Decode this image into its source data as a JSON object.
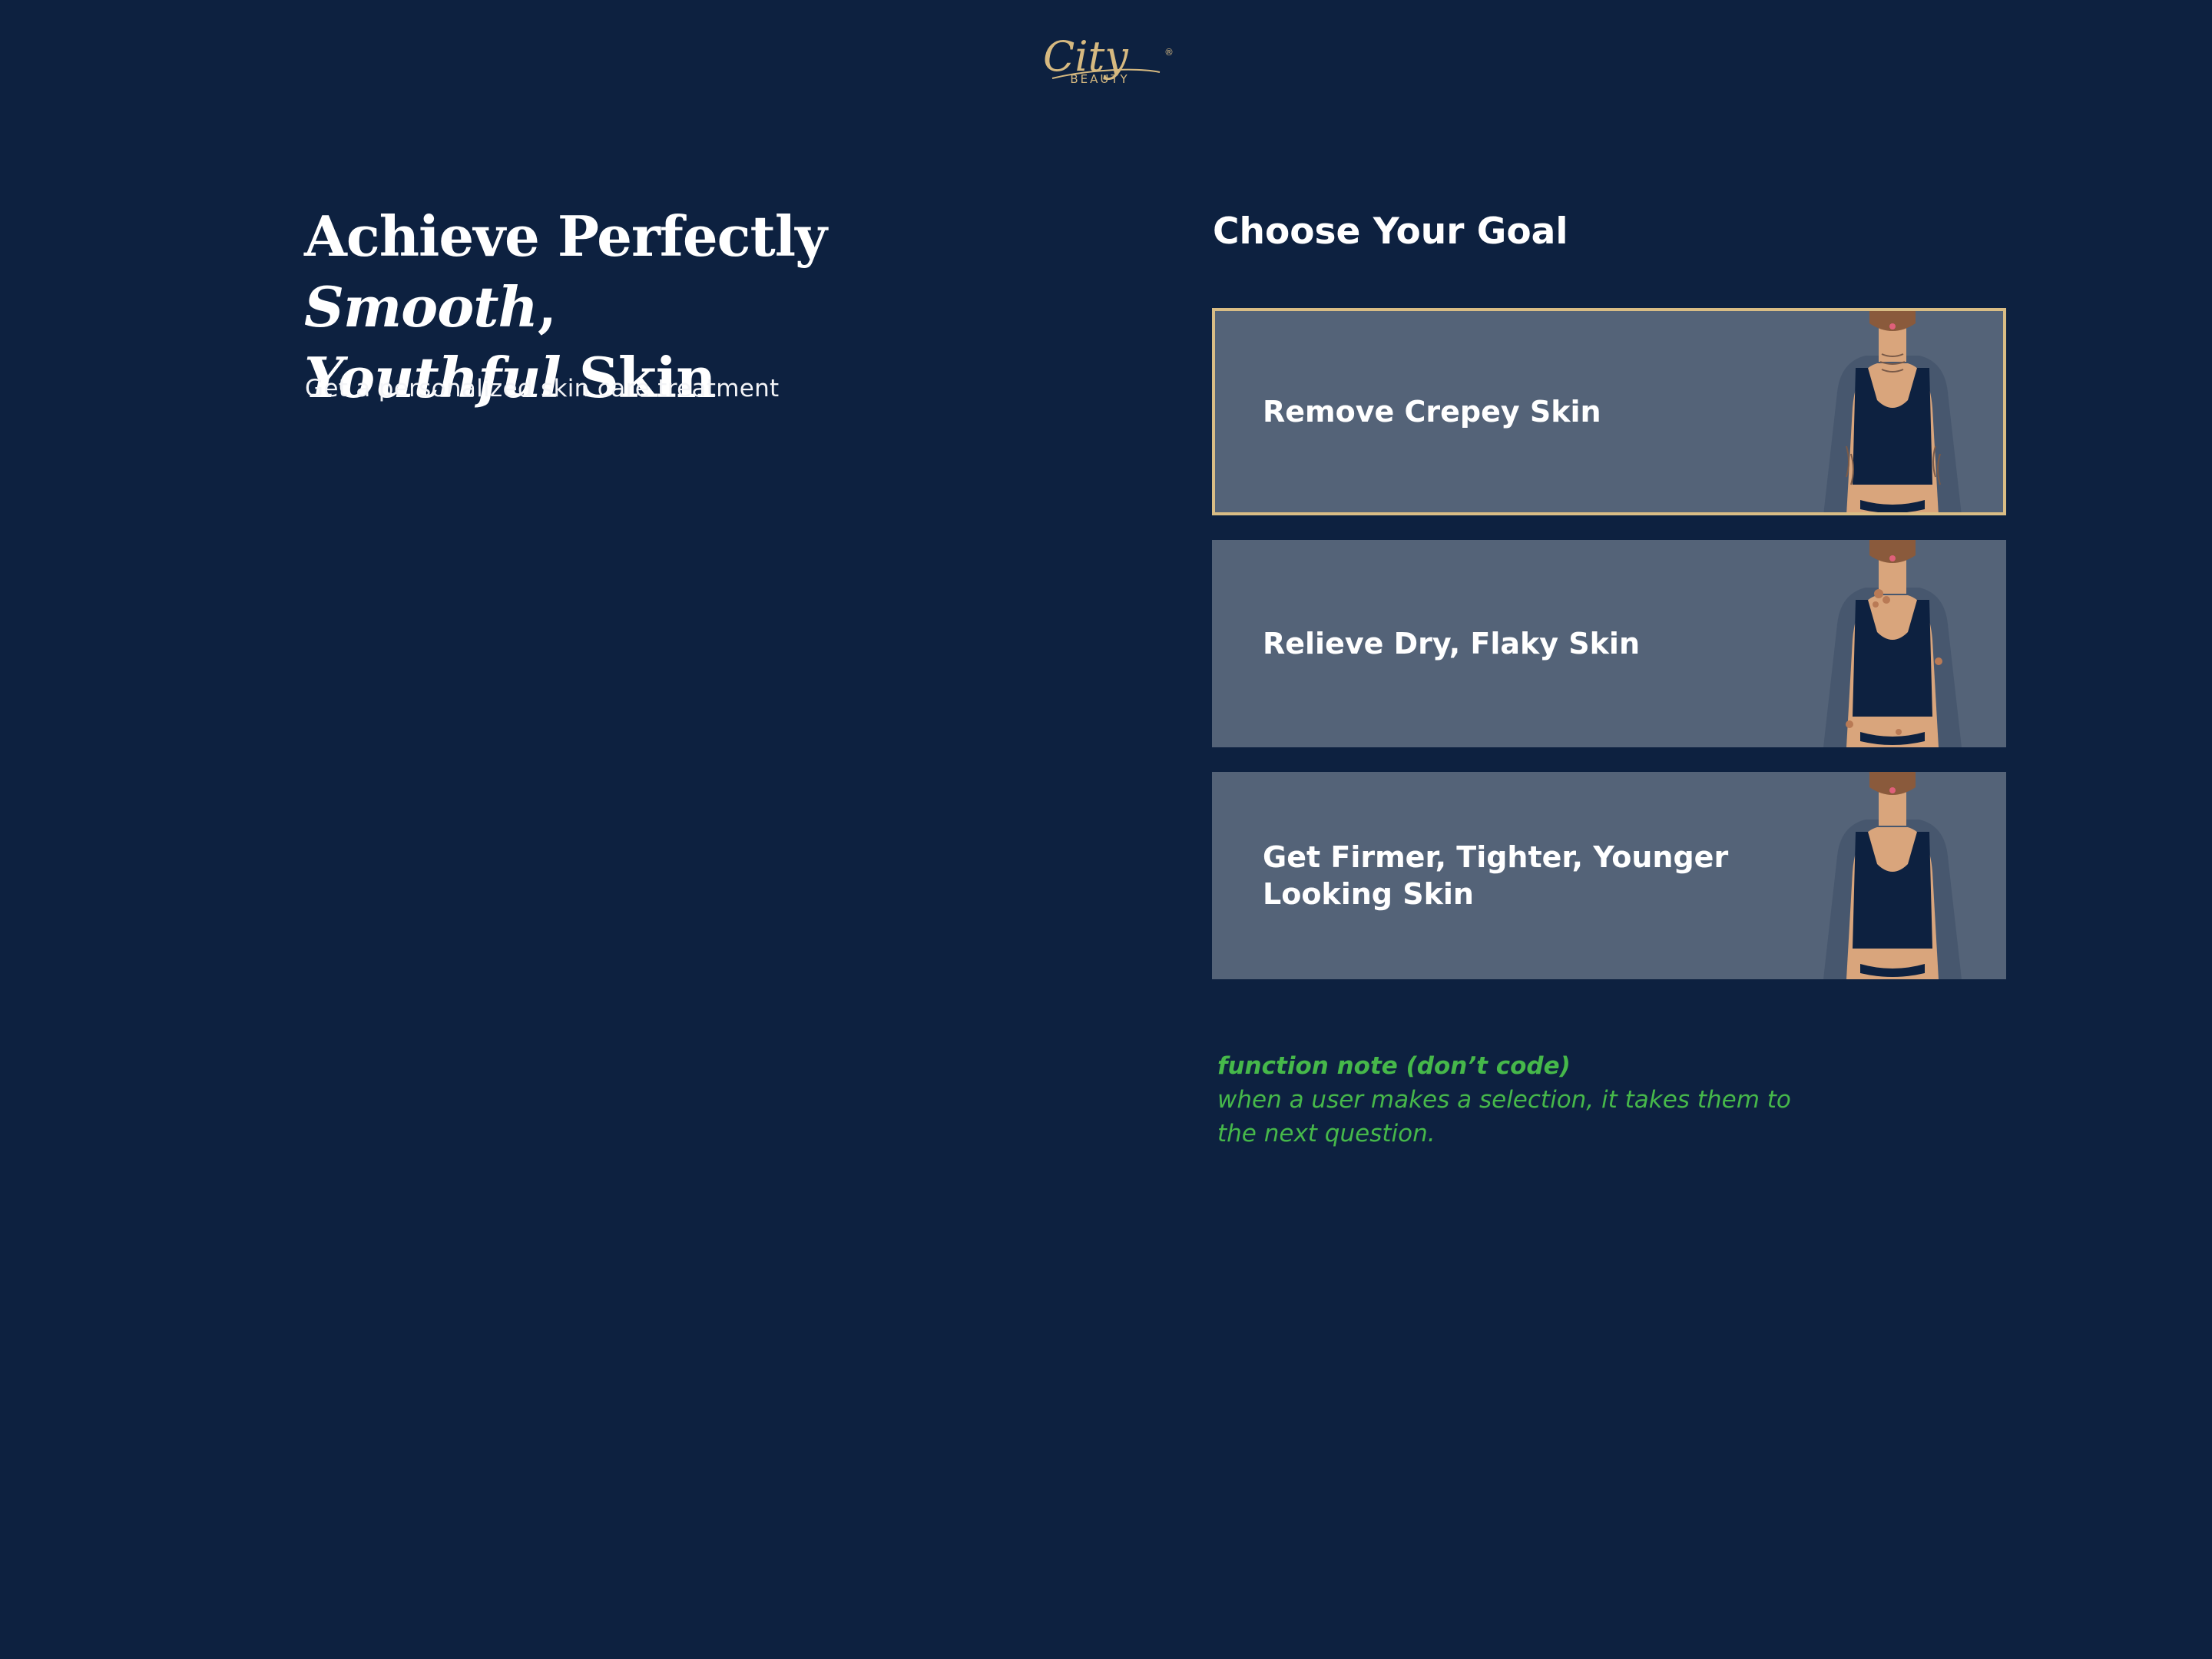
{
  "brand": {
    "logo_script": "City",
    "logo_sub": "BEAUTY",
    "logo_mark": "®",
    "accent_color": "#d6b980"
  },
  "hero": {
    "headline_part1": "Achieve Perfectly ",
    "headline_italic1": "Smooth",
    "headline_part2": ", ",
    "headline_italic2": "Youthful",
    "headline_part3": " Skin",
    "subhead": "Get a personalized skin care treatment"
  },
  "goals": {
    "title": "Choose Your Goal",
    "options": [
      {
        "label": "Remove Crepey Skin",
        "selected": true,
        "icon": "woman-crepey-skin-illustration"
      },
      {
        "label": "Relieve Dry, Flaky Skin",
        "selected": false,
        "icon": "woman-dry-skin-illustration"
      },
      {
        "label": "Get Firmer, Tighter, Younger Looking Skin",
        "selected": false,
        "icon": "woman-firm-skin-illustration"
      }
    ]
  },
  "note": {
    "title": "function note (don’t code)",
    "body": "when a user makes a selection, it takes them to the next question."
  },
  "colors": {
    "background": "#0d2140",
    "card": "#546378",
    "selected_border": "#d9bd85",
    "note": "#46b84a"
  }
}
